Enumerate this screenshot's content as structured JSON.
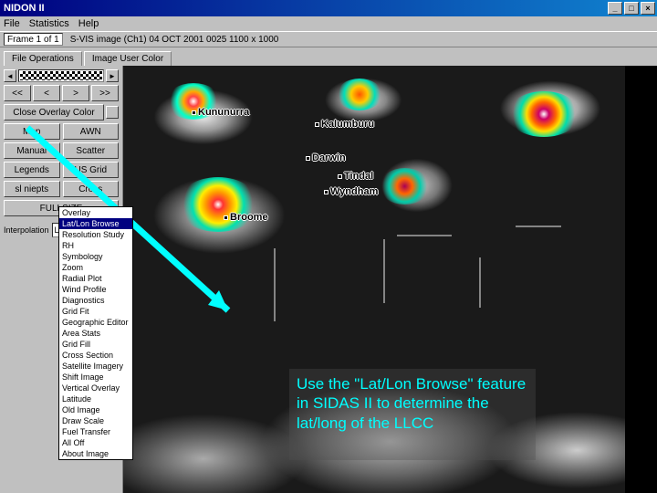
{
  "window": {
    "title": "NIDON II",
    "min": "_",
    "max": "□",
    "close": "×"
  },
  "menu": {
    "file": "File",
    "statistics": "Statistics",
    "help": "Help"
  },
  "toolbar": {
    "frame_label": "Frame 1 of 1",
    "image_info": "S-VIS image (Ch1)   04 OCT 2001 0025   1100 x 1000"
  },
  "tabs": {
    "t1": "File Operations",
    "t2": "Image User Color"
  },
  "slider": {
    "left": "◄",
    "right": "►"
  },
  "nav": {
    "first": "<<",
    "prev": "<",
    "next": ">",
    "last": ">>"
  },
  "close_overlay": "Close Overlay Color",
  "buttons": {
    "map": "Map",
    "awn": "AWN",
    "manual": "Manual",
    "scatter": "Scatter",
    "legends": "Legends",
    "usgrid": "US Grid",
    "sniepts": "sl niepts",
    "cross": "Cross",
    "fullsize": "FULLSIZE"
  },
  "combo": {
    "label": "Interpolation",
    "value": "Lat/Lon Browse",
    "arrow": "▼"
  },
  "dropdown_items": [
    "Overlay",
    "Lat/Lon Browse",
    "Resolution Study",
    "RH",
    "Symbology",
    "Zoom",
    "Radial Plot",
    "Wind Profile",
    "Diagnostics",
    "Grid Fit",
    "Geographic Editor",
    "Area Stats",
    "Grid Fill",
    "Cross Section",
    "Satellite Imagery",
    "Shift Image",
    "Vertical Overlay",
    "Latitude",
    "Old Image",
    "Draw Scale",
    "Fuel Transfer",
    "All Off",
    "About Image"
  ],
  "cities": {
    "kununurra": "Kununurra",
    "kalumburu": "Kalumburu",
    "darwin": "Darwin",
    "tindal": "Tindal",
    "wyndham": "Wyndham",
    "broome": "Broome"
  },
  "annotation": "Use the \"Lat/Lon Browse\" feature in SIDAS II to determine the lat/long of the LLCC"
}
